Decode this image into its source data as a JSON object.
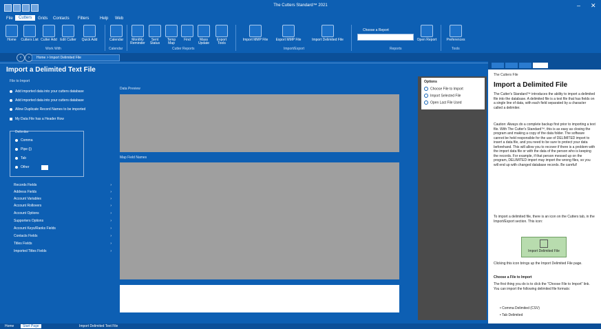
{
  "title_bar": {
    "title": "The Cutters Standard™ 2021",
    "minimize": "–",
    "close": "✕"
  },
  "menu": [
    {
      "label": "File",
      "active": false
    },
    {
      "label": "Cutters",
      "active": true
    },
    {
      "label": "Grids",
      "active": false
    },
    {
      "label": "Contacts",
      "active": false
    },
    {
      "label": "Filters",
      "active": false
    },
    {
      "label": "Help",
      "active": false
    },
    {
      "label": "Web",
      "active": false
    }
  ],
  "ribbon": {
    "buttons": [
      {
        "label": "Home",
        "icon": "home-icon"
      },
      {
        "label": "Cutters List",
        "icon": "list-icon"
      },
      {
        "label": "Cutter Add",
        "icon": "add-icon"
      },
      {
        "label": "Edit Cutter",
        "icon": "edit-icon"
      },
      {
        "label": "Quick Add",
        "icon": "quick-add-icon"
      },
      {
        "label": "Calendar",
        "icon": "calendar-icon"
      },
      {
        "label": "Monthly Reminder",
        "icon": "reminder-icon"
      },
      {
        "label": "Sent Status",
        "icon": "status-icon"
      },
      {
        "label": "Temp Map",
        "icon": "map-icon"
      },
      {
        "label": "Find",
        "icon": "find-icon"
      },
      {
        "label": "Mass Update",
        "icon": "mass-update-icon"
      },
      {
        "label": "Export Tools",
        "icon": "export-icon"
      },
      {
        "label": "Import MMP File",
        "icon": "import-mmp-icon"
      },
      {
        "label": "Export MMP File",
        "icon": "export-mmp-icon"
      },
      {
        "label": "Import Delimited File",
        "icon": "import-delimited-icon"
      },
      {
        "label": "Open Report",
        "icon": "report-icon"
      },
      {
        "label": "Preferences",
        "icon": "preferences-icon"
      }
    ],
    "groups": [
      "Work With",
      "Calendar",
      "Cutter Reports",
      "Import/Export",
      "Reports",
      "Tools"
    ],
    "choose_label": "Choose a Report"
  },
  "address": {
    "back": "‹",
    "forward": "›",
    "path": "Home > Import Delimited File"
  },
  "page": {
    "heading": "Import a Delimited Text File",
    "file_label": "File to Import",
    "import_options": [
      {
        "label": "Add imported data into your cutters database",
        "kind": "radio"
      },
      {
        "label": "Add imported data into your cutters database",
        "kind": "radio"
      },
      {
        "label": "Allow Duplicate Record Names to be imported",
        "kind": "radio"
      },
      {
        "label": "My Data File has a Header Row",
        "kind": "check"
      }
    ],
    "delimiters": {
      "label": "Delimiter",
      "items": [
        "Comma",
        "Pipe (|)",
        "Tab",
        "Other"
      ]
    },
    "field_groups": [
      "Records Fields",
      "Address Fields",
      "Account Variables",
      "Account Rollovers",
      "Account Options",
      "Supporters Options",
      "Account Keys/Ranks Fields",
      "Contacts Fields",
      "Titles Fields",
      "Imported Titles Fields"
    ],
    "data_preview_label": "Data Preview",
    "map_fields_label": "Map Field Names"
  },
  "options_panel": {
    "title": "Options",
    "items": [
      "Choose File to Import",
      "Import Selected File",
      "Open Last File Used"
    ]
  },
  "help": {
    "crumb": "The Cutters File",
    "title": "Import a Delimited File",
    "para1": "The Cutter's Standard™ introduces the ability to import a delimited file into the database. A delimited file is a text file that has fields on a single line of data, with each field separated by a character called a delimiter.",
    "para2": "Caution: Always do a complete backup first prior to importing a text file. With The Cutter's Standard™, this is as easy as closing the program and making a copy of the data folder. The software cannot be held responsible for the use of DELIMITED import to insert a data file, and you need to be sure to protect your data beforehand. This will allow you to recover if there is a problem with the import data file or with the data of the person who is keeping the records. For example, if that person messed up on the program, DELIMITED import may import the wrong files, so you will end up with changed database records. Be careful!",
    "para3": "To import a delimited file, there is an icon on the Cutters tab, in the Import/Export section. This icon:",
    "button_label": "Import Delimited File",
    "para4": "Clicking this icon brings up the Import Delimited File page.",
    "sub_heading": "Choose a File to Import",
    "para5": "The first thing you do is to click the \"Choose File to Import\" link. You can import the following delimited file formats:",
    "formats": [
      "Comma Delimited (CSV)",
      "Tab Delimited"
    ]
  },
  "status_bar": {
    "tabs": [
      {
        "label": "Home",
        "active": false
      },
      {
        "label": "Start Page",
        "active": true
      },
      {
        "label": "Import Delimited Text File",
        "active": false
      }
    ]
  },
  "colors": {
    "brand": "#0d5fb3",
    "dark": "#0b4f98",
    "panel": "#4b4b4b",
    "preview": "#9f9f9f"
  }
}
